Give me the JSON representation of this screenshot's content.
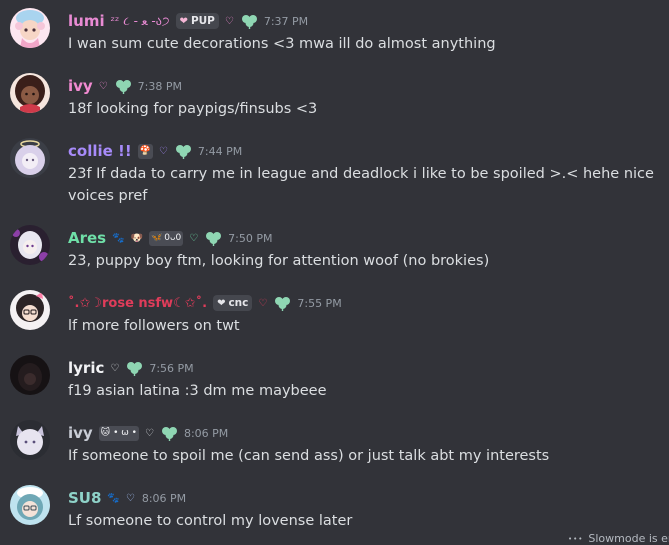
{
  "messages": [
    {
      "username": "lumi",
      "fancy_tag": "ᶻᶻ ૮ - ﻌ -ა੭",
      "tag_chip": "PUP",
      "time": "7:37 PM",
      "text": "I wan sum cute decorations <3 mwa ill do almost anything",
      "name_color": "#e98bd4"
    },
    {
      "username": "ivy",
      "time": "7:38 PM",
      "text": "18f looking for paypigs/finsubs <3",
      "name_color": "#f28bd2"
    },
    {
      "username": "collie !!",
      "time": "7:44 PM",
      "text": "23f If dada to carry me in league and deadlock i like to be spoiled >.< hehe nice voices pref",
      "name_color": "#a78bfa"
    },
    {
      "username": "Ares",
      "mini_badge": "0ᴗ0",
      "time": "7:50 PM",
      "text": "23, puppy boy ftm, looking for attention woof (no brokies)",
      "name_color": "#6fe0a8"
    },
    {
      "username": "˚.✩☽rose nsfw☾✩˚.",
      "tag_chip": "cnc",
      "time": "7:55 PM",
      "text": "lf more followers on twt",
      "name_color": "#e03c5a"
    },
    {
      "username": "lyric",
      "time": "7:56 PM",
      "text": "f19 asian latina :3 dm me maybeee",
      "name_color": "#f2f3f5"
    },
    {
      "username": "ivy",
      "mini_badge": "• ω •",
      "time": "8:06 PM",
      "text": "If someone to spoil me (can send ass) or just talk abt my interests",
      "name_color": "#c9cdd6"
    },
    {
      "username": "SU8",
      "time": "8:06 PM",
      "text": "Lf someone to control my lovense later",
      "name_color": "#8fd3c9"
    }
  ],
  "footer": {
    "slowmode": "Slowmode is ena"
  },
  "colors": {
    "background": "#323339",
    "timestamp": "#949ba4",
    "message_text": "#dbdee1",
    "clover_green": "#8fd6b3"
  },
  "icons": {
    "heart": "heart-icon",
    "clover": "clover-icon",
    "paw": "paw-icon"
  }
}
